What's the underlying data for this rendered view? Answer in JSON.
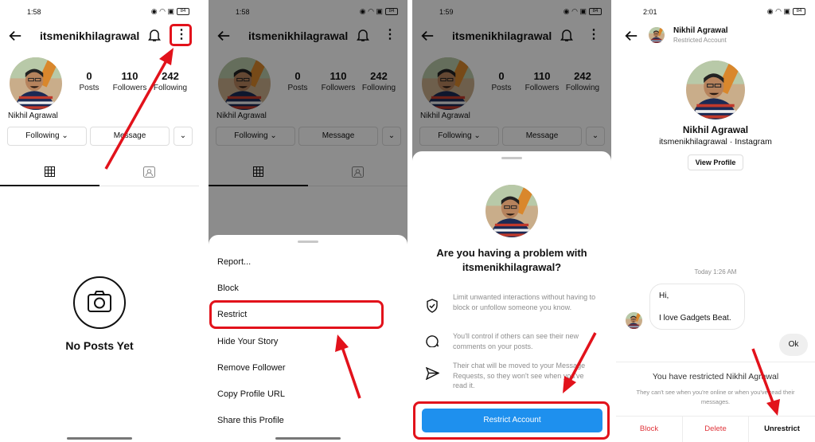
{
  "screen1": {
    "status_time": "1:58",
    "battery": "84",
    "username": "itsmenikhilagrawal",
    "stats": [
      {
        "value": "0",
        "label": "Posts"
      },
      {
        "value": "110",
        "label": "Followers"
      },
      {
        "value": "242",
        "label": "Following"
      }
    ],
    "full_name": "Nikhil Agrawal",
    "following_button": "Following ⌄",
    "message_button": "Message",
    "empty_title": "No Posts Yet"
  },
  "screen2": {
    "status_time": "1:58",
    "battery": "84",
    "menu_items": [
      "Report...",
      "Block",
      "Restrict",
      "Hide Your Story",
      "Remove Follower",
      "Copy Profile URL",
      "Share this Profile"
    ]
  },
  "screen3": {
    "status_time": "1:59",
    "battery": "84",
    "title": "Are you having a problem with itsmenikhilagrawal?",
    "features": [
      "Limit unwanted interactions without having to block or unfollow someone you know.",
      "You'll control if others can see their new comments on your posts.",
      "Their chat will be moved to your Message Requests, so they won't see when you've read it."
    ],
    "restrict_button": "Restrict Account"
  },
  "screen4": {
    "status_time": "2:01",
    "battery": "84",
    "header_name": "Nikhil Agrawal",
    "header_subtitle": "Restricted Account",
    "profile_name": "Nikhil Agrawal",
    "profile_sub": "itsmenikhilagrawal · Instagram",
    "view_profile": "View Profile",
    "timestamp": "Today 1:26 AM",
    "msg_line1": "Hi,",
    "msg_line2": "I love Gadgets Beat.",
    "my_reply": "Ok",
    "restricted_title": "You have restricted Nikhil Agrawal",
    "restricted_desc": "They can't see when you're online or when you've read their messages.",
    "actions": [
      "Block",
      "Delete",
      "Unrestrict"
    ]
  },
  "colors": {
    "accent_blue": "#1e90ee",
    "highlight_red": "#e2121b",
    "destructive_red": "#e0353b"
  }
}
